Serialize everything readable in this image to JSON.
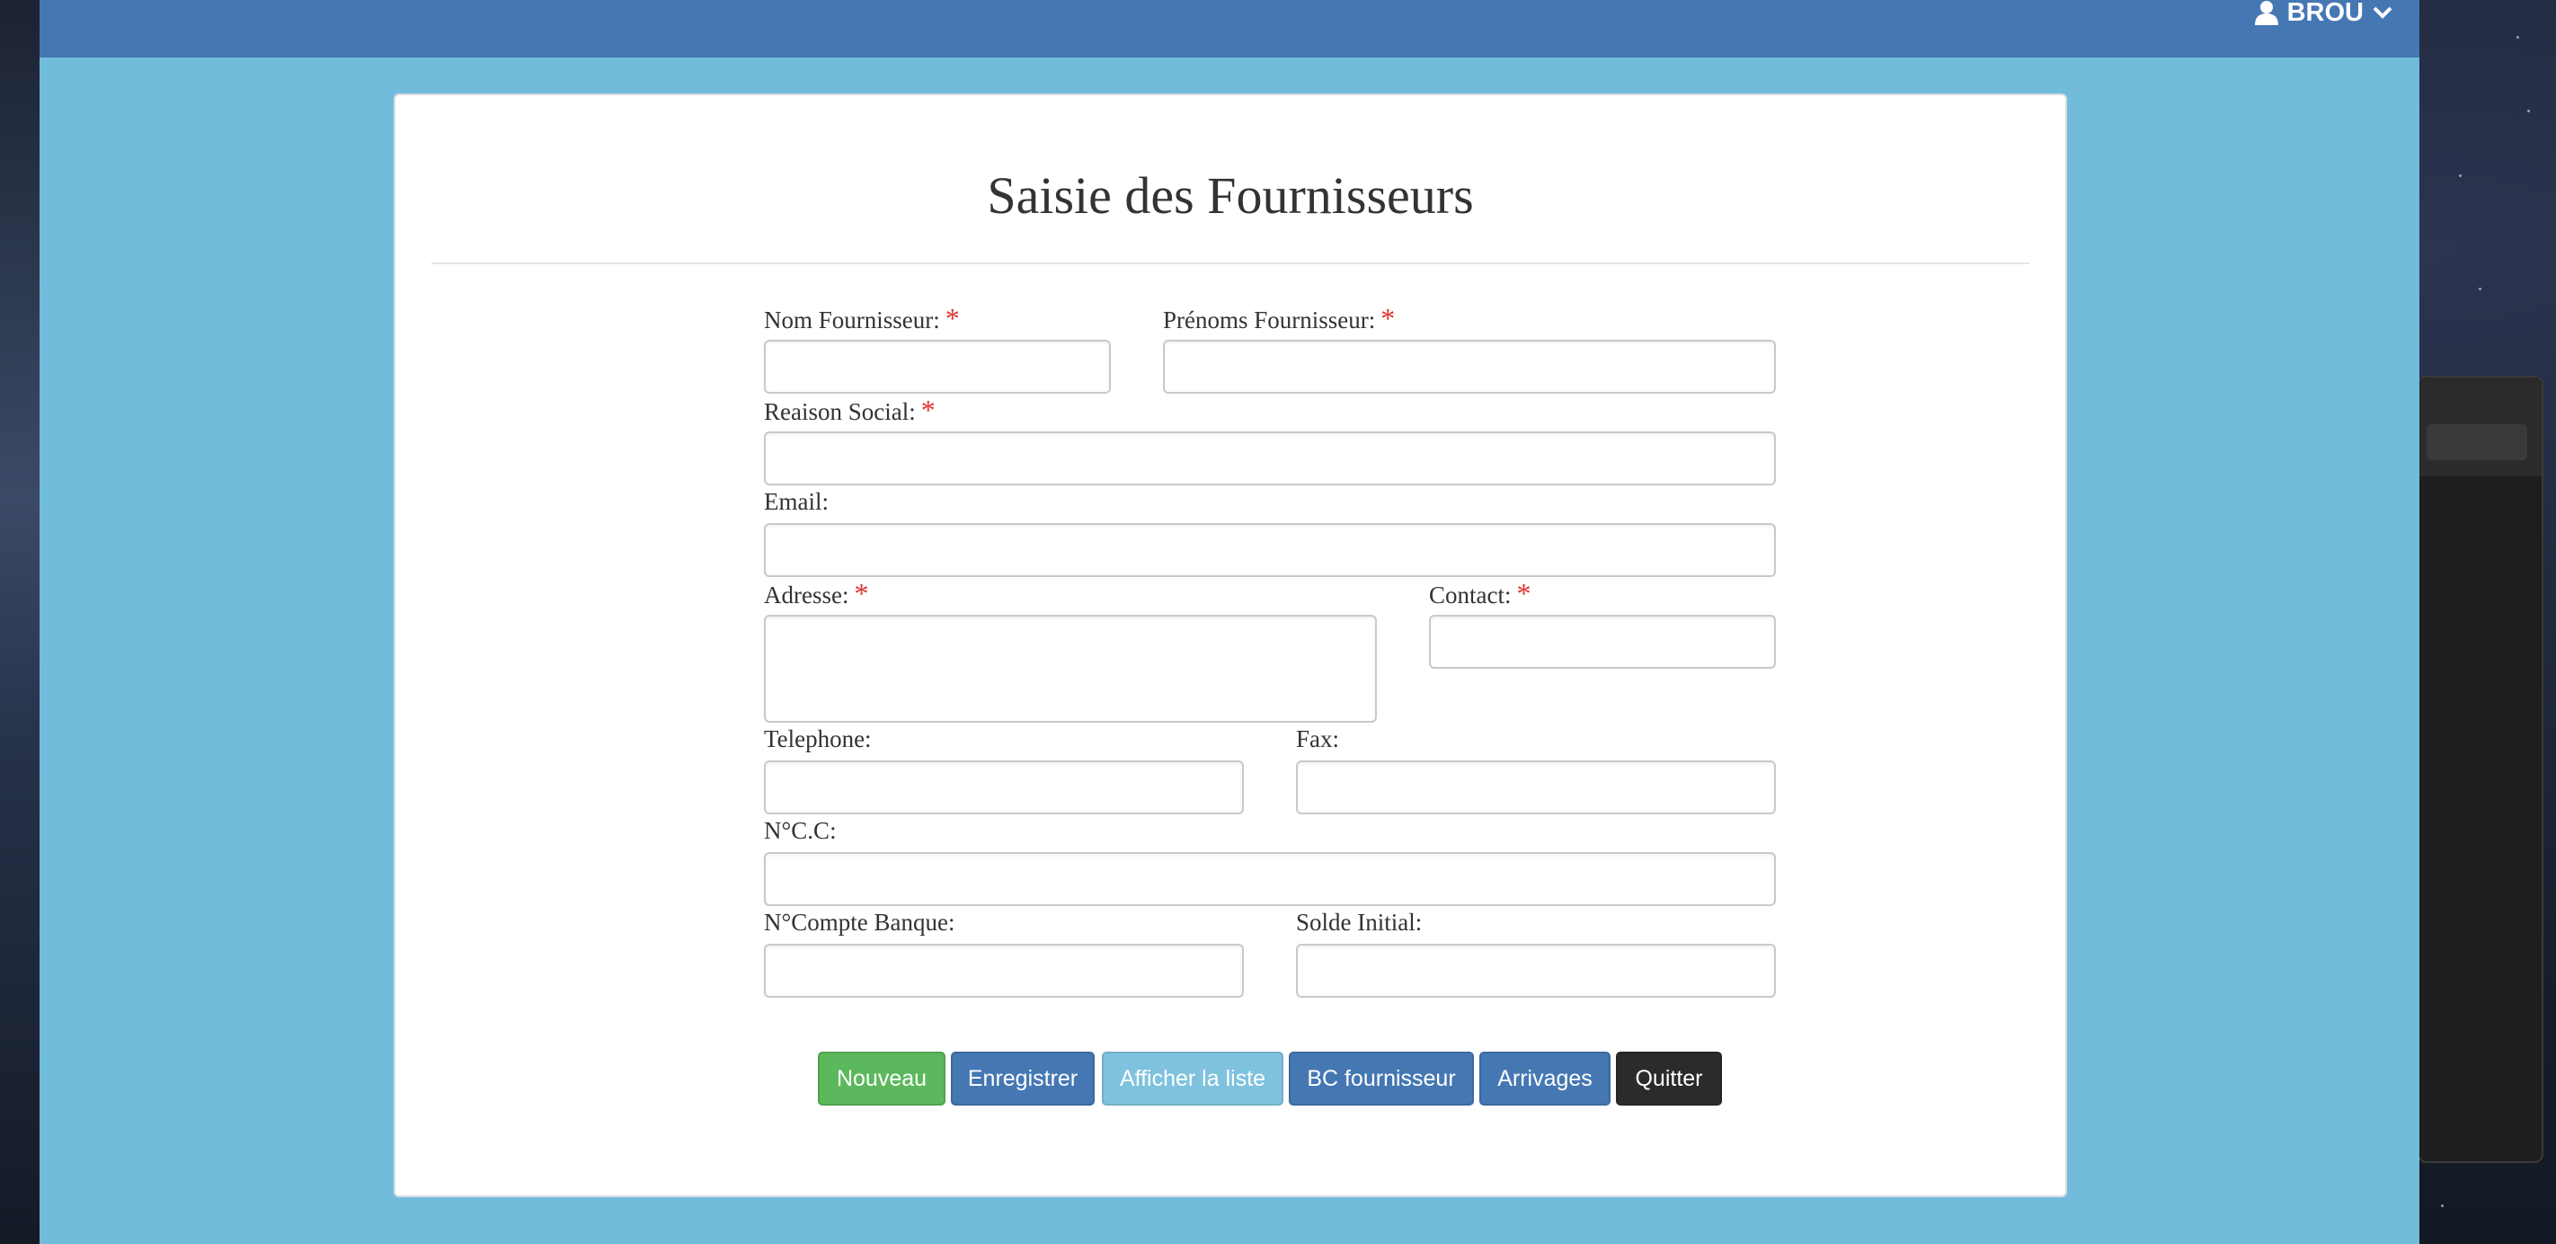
{
  "user": {
    "name": "BROU"
  },
  "form": {
    "title": "Saisie des Fournisseurs",
    "required_marker": "*",
    "fields": {
      "nom": {
        "label": "Nom Fournisseur:",
        "value": ""
      },
      "prenoms": {
        "label": "Prénoms Fournisseur:",
        "value": ""
      },
      "raison_social": {
        "label": "Reaison Social:",
        "value": ""
      },
      "email": {
        "label": "Email:",
        "value": ""
      },
      "adresse": {
        "label": "Adresse:",
        "value": ""
      },
      "contact": {
        "label": "Contact:",
        "value": ""
      },
      "telephone": {
        "label": "Telephone:",
        "value": ""
      },
      "fax": {
        "label": "Fax:",
        "value": ""
      },
      "ncc": {
        "label": "N°C.C:",
        "value": ""
      },
      "compte_banque": {
        "label": "N°Compte Banque:",
        "value": ""
      },
      "solde_initial": {
        "label": "Solde Initial:",
        "value": ""
      }
    }
  },
  "buttons": {
    "nouveau": {
      "label": "Nouveau",
      "color": "#5cb85c"
    },
    "enregistrer": {
      "label": "Enregistrer",
      "color": "#4577b3"
    },
    "afficher_liste": {
      "label": "Afficher la liste",
      "color": "#72bcdb"
    },
    "bc_fournisseur": {
      "label": "BC fournisseur",
      "color": "#4577b3"
    },
    "arrivages": {
      "label": "Arrivages",
      "color": "#4577b3"
    },
    "quitter": {
      "label": "Quitter",
      "color": "#2b2b2b"
    }
  },
  "icons": {
    "user": "user-icon",
    "dropdown": "chevron-down-icon"
  },
  "colors": {
    "topbar": "#4577b3",
    "page_background": "#72bcdb",
    "required": "#e03131"
  }
}
